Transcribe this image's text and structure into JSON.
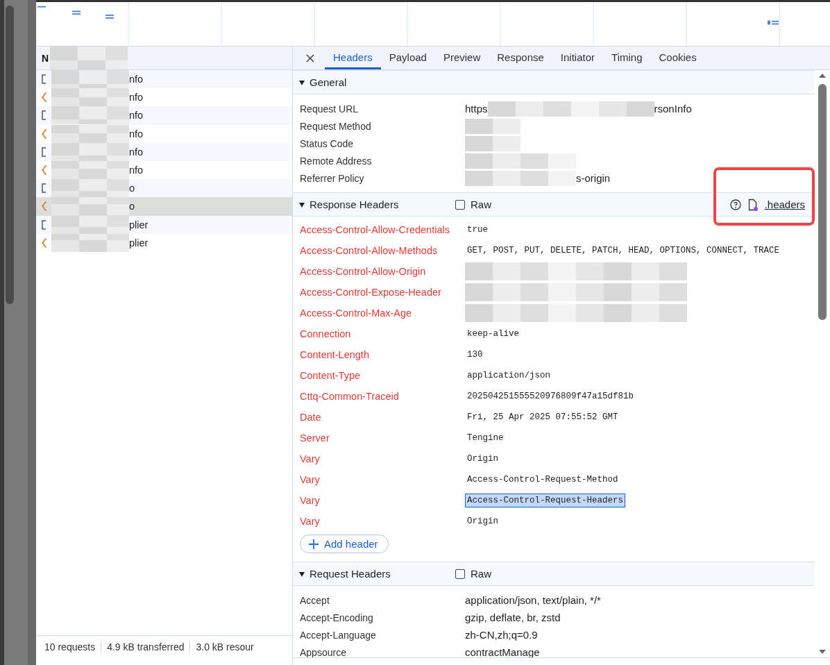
{
  "requests": {
    "column_1": "N",
    "rows": [
      {
        "name": "nfo",
        "kind": "document",
        "selected": false
      },
      {
        "name": "nfo",
        "kind": "fetch",
        "selected": false
      },
      {
        "name": "nfo",
        "kind": "document",
        "selected": false
      },
      {
        "name": "nfo",
        "kind": "fetch",
        "selected": false
      },
      {
        "name": "nfo",
        "kind": "document",
        "selected": false
      },
      {
        "name": "nfo",
        "kind": "fetch",
        "selected": false
      },
      {
        "name": "o",
        "kind": "document",
        "selected": false
      },
      {
        "name": "o",
        "kind": "fetch",
        "selected": true
      },
      {
        "name": "plier",
        "kind": "document",
        "selected": false
      },
      {
        "name": "plier",
        "kind": "fetch",
        "selected": false
      }
    ],
    "status_bar": [
      "10 requests",
      "4.9 kB transferred",
      "3.0 kB resour"
    ]
  },
  "details": {
    "tabs": [
      {
        "label": "Headers",
        "selected": true
      },
      {
        "label": "Payload",
        "selected": false
      },
      {
        "label": "Preview",
        "selected": false
      },
      {
        "label": "Response",
        "selected": false
      },
      {
        "label": "Initiator",
        "selected": false
      },
      {
        "label": "Timing",
        "selected": false
      },
      {
        "label": "Cookies",
        "selected": false
      }
    ],
    "general": {
      "title": "General",
      "expanded": true,
      "rows": [
        {
          "name": "Request URL",
          "parts": [
            {
              "kind": "text",
              "text": "https"
            },
            {
              "kind": "redacted"
            },
            {
              "kind": "text",
              "text": "rsonInfo"
            }
          ]
        },
        {
          "name": "Request Method",
          "parts": [
            {
              "kind": "redacted"
            }
          ]
        },
        {
          "name": "Status Code",
          "parts": [
            {
              "kind": "redacted"
            }
          ]
        },
        {
          "name": "Remote Address",
          "parts": [
            {
              "kind": "redacted"
            }
          ]
        },
        {
          "name": "Referrer Policy",
          "parts": [
            {
              "kind": "redacted"
            },
            {
              "kind": "text",
              "text": "s-origin"
            }
          ]
        }
      ]
    },
    "response_headers": {
      "title": "Response Headers",
      "expanded": true,
      "raw": {
        "label": "Raw",
        "checked": false
      },
      "link": ".headers",
      "annotated": true,
      "add_button": "Add header",
      "rows": [
        {
          "name": "Access-Control-Allow-Credentials",
          "value": "true",
          "redacted": false,
          "selected": false
        },
        {
          "name": "Access-Control-Allow-Methods",
          "value": "GET, POST, PUT, DELETE, PATCH, HEAD, OPTIONS, CONNECT, TRACE",
          "redacted": false,
          "selected": false
        },
        {
          "name": "Access-Control-Allow-Origin",
          "redacted": true,
          "selected": false
        },
        {
          "name": "Access-Control-Expose-Header",
          "redacted": true,
          "selected": false
        },
        {
          "name": "Access-Control-Max-Age",
          "redacted": true,
          "selected": false
        },
        {
          "name": "Connection",
          "value": "keep-alive",
          "redacted": false,
          "selected": false
        },
        {
          "name": "Content-Length",
          "value": "130",
          "redacted": false,
          "selected": false
        },
        {
          "name": "Content-Type",
          "value": "application/json",
          "redacted": false,
          "selected": false
        },
        {
          "name": "Cttq-Common-Traceid",
          "value": "202504251555520976809f47a15df81b",
          "redacted": false,
          "selected": false
        },
        {
          "name": "Date",
          "value": "Fri, 25 Apr 2025 07:55:52 GMT",
          "redacted": false,
          "selected": false
        },
        {
          "name": "Server",
          "value": "Tengine",
          "redacted": false,
          "selected": false
        },
        {
          "name": "Vary",
          "value": "Origin",
          "redacted": false,
          "selected": false
        },
        {
          "name": "Vary",
          "value": "Access-Control-Request-Method",
          "redacted": false,
          "selected": false
        },
        {
          "name": "Vary",
          "value": "Access-Control-Request-Headers",
          "redacted": false,
          "selected": true
        },
        {
          "name": "Vary",
          "value": "Origin",
          "redacted": false,
          "selected": false
        }
      ]
    },
    "request_headers": {
      "title": "Request Headers",
      "expanded": true,
      "raw": {
        "label": "Raw",
        "checked": false
      },
      "rows": [
        {
          "name": "Accept",
          "value": "application/json, text/plain, */*"
        },
        {
          "name": "Accept-Encoding",
          "value": "gzip, deflate, br, zstd"
        },
        {
          "name": "Accept-Language",
          "value": "zh-CN,zh;q=0.9"
        },
        {
          "name": "Appsource",
          "value": "contractManage"
        }
      ]
    }
  }
}
